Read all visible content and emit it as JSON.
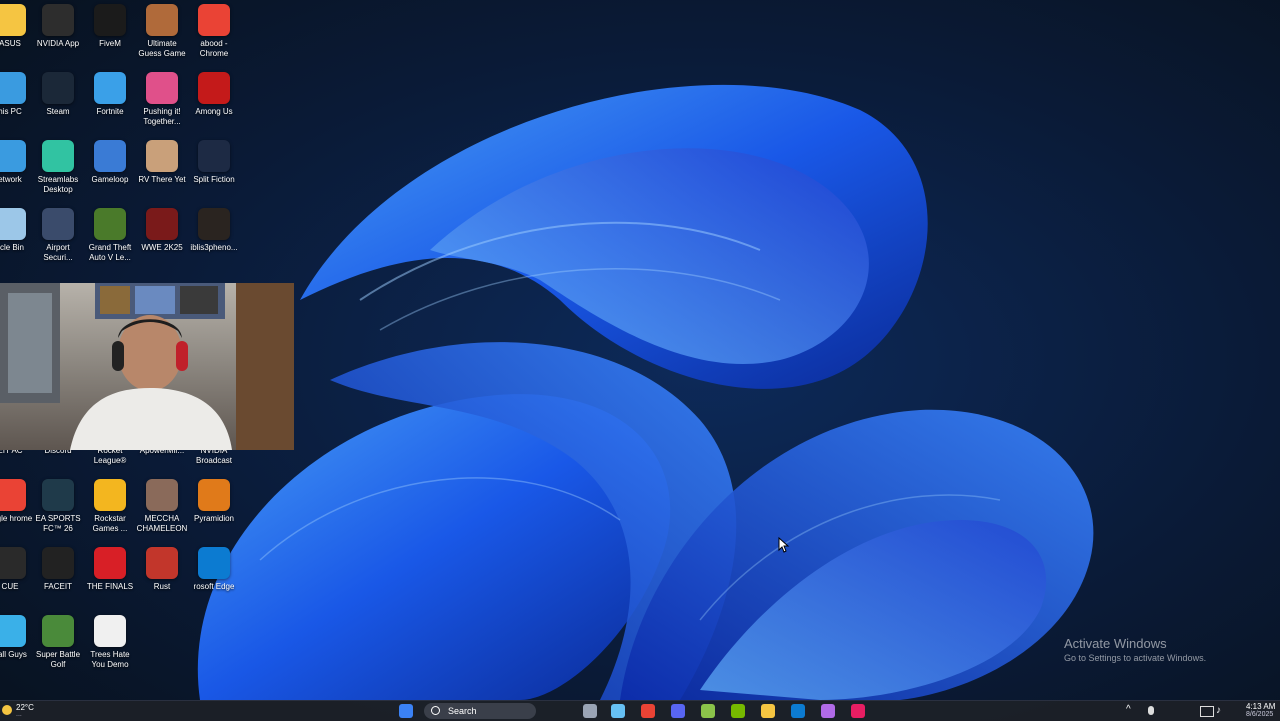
{
  "desktop_icons": [
    {
      "label": "ASUS",
      "icon": "folder-icon",
      "color": "#f5c542"
    },
    {
      "label": "NVIDIA App",
      "icon": "nvidia-icon",
      "color": "#2d2d2d"
    },
    {
      "label": "FiveM",
      "icon": "fivem-icon",
      "color": "#1b1b1b"
    },
    {
      "label": "Ultimate Guess Game",
      "icon": "ultimate-guess-game-icon",
      "color": "#b06a3a"
    },
    {
      "label": "abood - Chrome",
      "icon": "chrome-icon",
      "color": "#ea4335"
    },
    {
      "label": "his PC",
      "icon": "this-pc-icon",
      "color": "#3a9be0"
    },
    {
      "label": "Steam",
      "icon": "steam-icon",
      "color": "#1b2838"
    },
    {
      "label": "Fortnite",
      "icon": "fortnite-icon",
      "color": "#3aa0e8"
    },
    {
      "label": "Pushing it! Together...",
      "icon": "pushing-it-together-icon",
      "color": "#e0508a"
    },
    {
      "label": "Among Us",
      "icon": "among-us-icon",
      "color": "#c41a1a"
    },
    {
      "label": "etwork",
      "icon": "network-icon",
      "color": "#3a9be0"
    },
    {
      "label": "Streamlabs Desktop",
      "icon": "streamlabs-icon",
      "color": "#31c3a2"
    },
    {
      "label": "Gameloop",
      "icon": "gameloop-icon",
      "color": "#3a7bd5"
    },
    {
      "label": "RV There Yet",
      "icon": "rv-there-yet-icon",
      "color": "#c9a07a"
    },
    {
      "label": "Split Fiction",
      "icon": "split-fiction-icon",
      "color": "#1d2a44"
    },
    {
      "label": "ycle Bin",
      "icon": "recycle-bin-icon",
      "color": "#9cc7e8"
    },
    {
      "label": "Airport Securi...",
      "icon": "airport-security-icon",
      "color": "#3a4b6b"
    },
    {
      "label": "Grand Theft Auto V Le...",
      "icon": "gta-v-icon",
      "color": "#4a7a2a"
    },
    {
      "label": "WWE 2K25",
      "icon": "wwe-2k25-icon",
      "color": "#7a1a1a"
    },
    {
      "label": "iblis3pheno...",
      "icon": "iblis-icon",
      "color": "#2a2420"
    },
    {
      "label": "EIT AC",
      "icon": "cheat-ac-icon",
      "color": "#333333"
    },
    {
      "label": "Discord",
      "icon": "discord-icon",
      "color": "#5865f2"
    },
    {
      "label": "Rocket League®",
      "icon": "rocket-league-icon",
      "color": "#2a4a8a"
    },
    {
      "label": "ApowerMir...",
      "icon": "apowermirror-icon",
      "color": "#3a8ae0"
    },
    {
      "label": "NVIDIA Broadcast",
      "icon": "nvidia-broadcast-icon",
      "color": "#76b900"
    },
    {
      "label": "oogle hrome",
      "icon": "google-chrome-icon",
      "color": "#ea4335"
    },
    {
      "label": "EA SPORTS FC™ 26",
      "icon": "ea-sports-fc-icon",
      "color": "#1f3a4a"
    },
    {
      "label": "Rockstar Games ...",
      "icon": "rockstar-icon",
      "color": "#f3b61f"
    },
    {
      "label": "MECCHA CHAMELEON",
      "icon": "meccha-chameleon-icon",
      "color": "#8a6a5a"
    },
    {
      "label": "Pyramidion",
      "icon": "pyramidion-icon",
      "color": "#e07a1a"
    },
    {
      "label": "CUE",
      "icon": "icue-icon",
      "color": "#2a2a2a"
    },
    {
      "label": "FACEIT",
      "icon": "faceit-icon",
      "color": "#222222"
    },
    {
      "label": "THE FINALS",
      "icon": "the-finals-icon",
      "color": "#d81f26"
    },
    {
      "label": "Rust",
      "icon": "rust-icon",
      "color": "#c2362b"
    },
    {
      "label": "rosoft Edge",
      "icon": "edge-icon",
      "color": "#0c7bd1"
    },
    {
      "label": "Fall Guys",
      "icon": "fall-guys-icon",
      "color": "#3ab0e8"
    },
    {
      "label": "Super Battle Golf",
      "icon": "super-battle-golf-icon",
      "color": "#4a8a3a"
    },
    {
      "label": "Trees Hate You Demo",
      "icon": "trees-hate-you-icon",
      "color": "#f0f0f0"
    }
  ],
  "watermark": {
    "title": "Activate Windows",
    "subtitle": "Go to Settings to activate Windows."
  },
  "taskbar": {
    "weather_temp": "22°C",
    "weather_desc": "...",
    "search_label": "Search",
    "time": "4:13 AM",
    "date": "8/6/2025",
    "pinned": [
      {
        "name": "start-icon",
        "color": "#3b82f6"
      },
      {
        "name": "task-view-icon",
        "color": "#9aa4b5"
      },
      {
        "name": "steam-icon",
        "color": "#66c0f4"
      },
      {
        "name": "chrome-icon",
        "color": "#ea4335"
      },
      {
        "name": "discord-icon",
        "color": "#5865f2"
      },
      {
        "name": "xbox-icon",
        "color": "#8bc34a"
      },
      {
        "name": "nvidia-icon",
        "color": "#76b900"
      },
      {
        "name": "file-explorer-icon",
        "color": "#f5c542"
      },
      {
        "name": "edge-icon",
        "color": "#0c7bd1"
      },
      {
        "name": "copilot-icon",
        "color": "#b06ae8"
      },
      {
        "name": "store-icon",
        "color": "#e81e63"
      }
    ]
  }
}
